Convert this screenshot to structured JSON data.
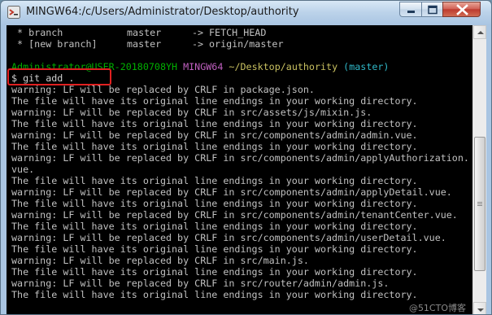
{
  "window": {
    "title": "MINGW64:/c/Users/Administrator/Desktop/authority",
    "controls": {
      "minimize_icon": "minimize-icon",
      "maximize_icon": "maximize-icon",
      "close_icon": "close-icon"
    }
  },
  "terminal": {
    "fetch_lines": [
      {
        "marker": " * ",
        "name": "branch",
        "source": "master",
        "arrow": "->",
        "target": "FETCH_HEAD"
      },
      {
        "marker": " * ",
        "name": "[new branch]",
        "source": "master",
        "arrow": "->",
        "target": "origin/master"
      }
    ],
    "prompt": {
      "user_host": "Administrator@USER-20180708YH",
      "env": "MINGW64",
      "path": "~/Desktop/authority",
      "branch": "(master)"
    },
    "command": "$ git add .",
    "output_lines": [
      "warning: LF will be replaced by CRLF in package.json.",
      "The file will have its original line endings in your working directory.",
      "warning: LF will be replaced by CRLF in src/assets/js/mixin.js.",
      "The file will have its original line endings in your working directory.",
      "warning: LF will be replaced by CRLF in src/components/admin/admin.vue.",
      "The file will have its original line endings in your working directory.",
      "warning: LF will be replaced by CRLF in src/components/admin/applyAuthorization.",
      "vue.",
      "The file will have its original line endings in your working directory.",
      "warning: LF will be replaced by CRLF in src/components/admin/applyDetail.vue.",
      "The file will have its original line endings in your working directory.",
      "warning: LF will be replaced by CRLF in src/components/admin/tenantCenter.vue.",
      "The file will have its original line endings in your working directory.",
      "warning: LF will be replaced by CRLF in src/components/admin/userDetail.vue.",
      "The file will have its original line endings in your working directory.",
      "warning: LF will be replaced by CRLF in src/main.js.",
      "The file will have its original line endings in your working directory.",
      "warning: LF will be replaced by CRLF in src/router/admin/admin.js.",
      "The file will have its original line endings in your working directory."
    ]
  },
  "watermark": "@51CTO博客",
  "colors": {
    "terminal_bg": "#000000",
    "terminal_fg": "#c0c0c0",
    "prompt_user": "#00b000",
    "prompt_env": "#c060c0",
    "prompt_path": "#c8c060",
    "prompt_branch": "#30b8c8",
    "highlight": "#e02020"
  },
  "scrollbar": {
    "position_fraction": 0.62
  }
}
